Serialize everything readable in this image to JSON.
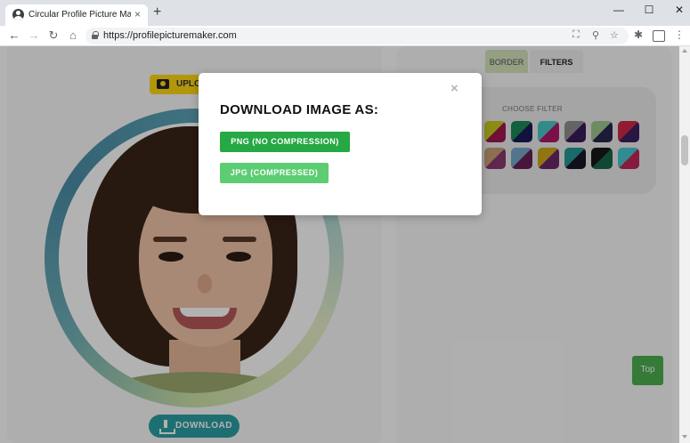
{
  "browser": {
    "tab_title": "Circular Profile Picture Maker",
    "tab_close": "×",
    "new_tab": "+",
    "window_controls": {
      "minimize": "—",
      "maximize": "☐",
      "close": "✕"
    },
    "nav": {
      "back": "←",
      "forward": "→",
      "reload": "↻",
      "home": "⌂"
    },
    "url": "https://profilepicturemaker.com",
    "omnibox_icons": {
      "translate": "⛶",
      "zoom": "⚲",
      "bookmark": "☆"
    },
    "toolbar_icons": {
      "extensions": "✱",
      "menu": "⋮"
    }
  },
  "editor": {
    "upload_label": "UPLOA",
    "download_label": "DOWNLOAD",
    "tabs": [
      {
        "label": "BORDER",
        "active": false
      },
      {
        "label": "FILTERS",
        "active": true
      }
    ],
    "filters": {
      "title": "CHOOSE FILTER",
      "swatches": [
        {
          "colors": [
            "#c8c820",
            "#a01850"
          ]
        },
        {
          "colors": [
            "#1a8a5a",
            "#1a1a5a"
          ]
        },
        {
          "colors": [
            "#48c8c8",
            "#b01868"
          ]
        },
        {
          "colors": [
            "#909090",
            "#3a1a5a"
          ]
        },
        {
          "colors": [
            "#a0c890",
            "#282850"
          ]
        },
        {
          "colors": [
            "#d02848",
            "#3a2060"
          ]
        },
        {
          "colors": [
            "#c8a078",
            "#883870"
          ]
        },
        {
          "colors": [
            "#78a8c8",
            "#682058"
          ]
        },
        {
          "colors": [
            "#d0a818",
            "#682868"
          ]
        },
        {
          "colors": [
            "#289898",
            "#181828"
          ]
        },
        {
          "colors": [
            "#181818",
            "#18684a"
          ]
        },
        {
          "colors": [
            "#48c8d0",
            "#c02858"
          ]
        }
      ]
    },
    "top_button": "Top"
  },
  "modal": {
    "title": "DOWNLOAD IMAGE AS:",
    "close": "×",
    "png_button": "PNG (NO COMPRESSION)",
    "jpg_button": "JPG (COMPRESSED)"
  }
}
